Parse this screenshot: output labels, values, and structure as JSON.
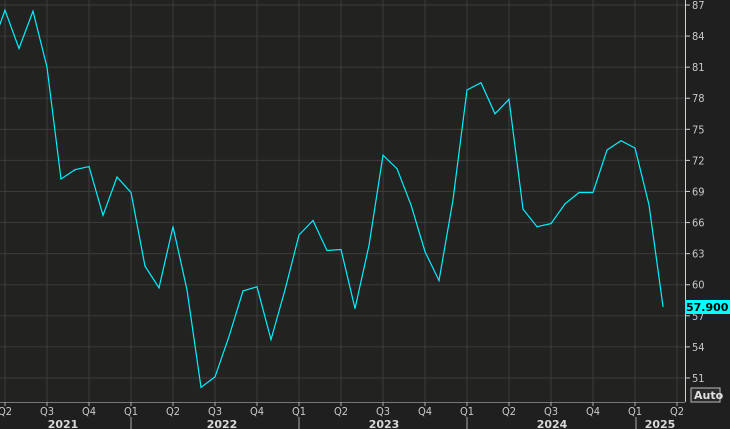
{
  "chart_data": {
    "type": "line",
    "title": "",
    "xlabel": "",
    "ylabel": "",
    "frequency": "monthly",
    "x": [
      "2021-03",
      "2021-04",
      "2021-05",
      "2021-06",
      "2021-07",
      "2021-08",
      "2021-09",
      "2021-10",
      "2021-11",
      "2021-12",
      "2022-01",
      "2022-02",
      "2022-03",
      "2022-04",
      "2022-05",
      "2022-06",
      "2022-07",
      "2022-08",
      "2022-09",
      "2022-10",
      "2022-11",
      "2022-12",
      "2023-01",
      "2023-02",
      "2023-03",
      "2023-04",
      "2023-05",
      "2023-06",
      "2023-07",
      "2023-08",
      "2023-09",
      "2023-10",
      "2023-11",
      "2023-12",
      "2024-01",
      "2024-02",
      "2024-03",
      "2024-04",
      "2024-05",
      "2024-06",
      "2024-07",
      "2024-08",
      "2024-09",
      "2024-10",
      "2024-11",
      "2024-12",
      "2025-01",
      "2025-02",
      "2025-03"
    ],
    "series": [
      {
        "name": "Series",
        "color": "#00f0ff",
        "values": [
          82.75,
          86.5,
          82.8,
          86.4,
          81.0,
          70.2,
          71.1,
          71.4,
          66.7,
          70.4,
          68.9,
          61.8,
          59.7,
          65.6,
          59.5,
          50.1,
          51.1,
          55.0,
          59.4,
          59.8,
          54.7,
          59.5,
          64.8,
          66.2,
          63.3,
          63.4,
          57.7,
          63.8,
          72.5,
          71.2,
          67.7,
          63.2,
          60.4,
          68.2,
          78.8,
          79.5,
          76.5,
          77.9,
          67.3,
          65.6,
          65.9,
          67.8,
          68.9,
          68.9,
          73.0,
          73.9,
          73.2,
          67.7,
          57.9
        ]
      }
    ],
    "ylim": [
      49.5,
      87.5
    ],
    "y_ticks": [
      "87",
      "84",
      "81",
      "78",
      "75",
      "72",
      "69",
      "66",
      "63",
      "60",
      "57",
      "54",
      "51"
    ],
    "x_quarter_ticks": [
      "Q2",
      "Q3",
      "Q4",
      "Q1",
      "Q2",
      "Q3",
      "Q4",
      "Q1",
      "Q2",
      "Q3",
      "Q4",
      "Q1",
      "Q2",
      "Q3",
      "Q4",
      "Q1",
      "Q2"
    ],
    "x_years": [
      "2021",
      "2022",
      "2023",
      "2024",
      "2025"
    ],
    "last_value_label": "57.900",
    "grid": true,
    "axis_position": "right"
  },
  "controls": {
    "auto_label": "Auto"
  }
}
